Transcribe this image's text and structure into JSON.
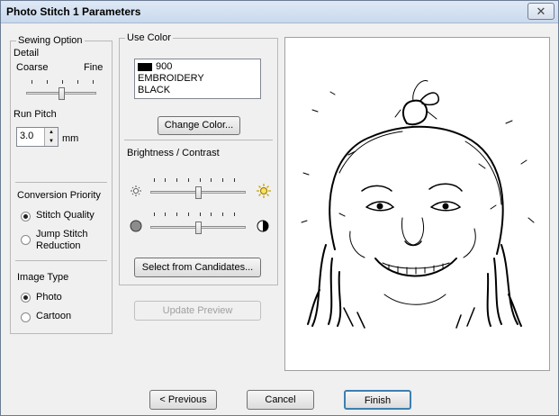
{
  "window": {
    "title": "Photo Stitch 1 Parameters",
    "close_glyph": "✕"
  },
  "sewing": {
    "legend": "Sewing Option",
    "detail_label": "Detail",
    "coarse_label": "Coarse",
    "fine_label": "Fine",
    "detail_level": 0.5,
    "run_pitch_label": "Run Pitch",
    "run_pitch_value": "3.0",
    "run_pitch_unit": "mm",
    "conversion_title": "Conversion Priority",
    "stitch_quality": "Stitch Quality",
    "jump_stitch_line1": "Jump Stitch",
    "jump_stitch_line2": "Reduction",
    "image_type_title": "Image Type",
    "photo": "Photo",
    "cartoon": "Cartoon"
  },
  "color": {
    "legend": "Use Color",
    "swatch_hex": "#000000",
    "code": "900",
    "brand": "EMBROIDERY",
    "name": "BLACK",
    "change_button": "Change Color..."
  },
  "adjust": {
    "title": "Brightness / Contrast",
    "brightness_level": 0.5,
    "contrast_level": 0.5,
    "icons": [
      "brightness-low-icon",
      "brightness-high-icon",
      "contrast-low-icon",
      "contrast-high-icon"
    ],
    "candidates_button": "Select from Candidates..."
  },
  "update_preview_button": "Update Preview",
  "footer": {
    "previous": "< Previous",
    "cancel": "Cancel",
    "finish": "Finish"
  }
}
